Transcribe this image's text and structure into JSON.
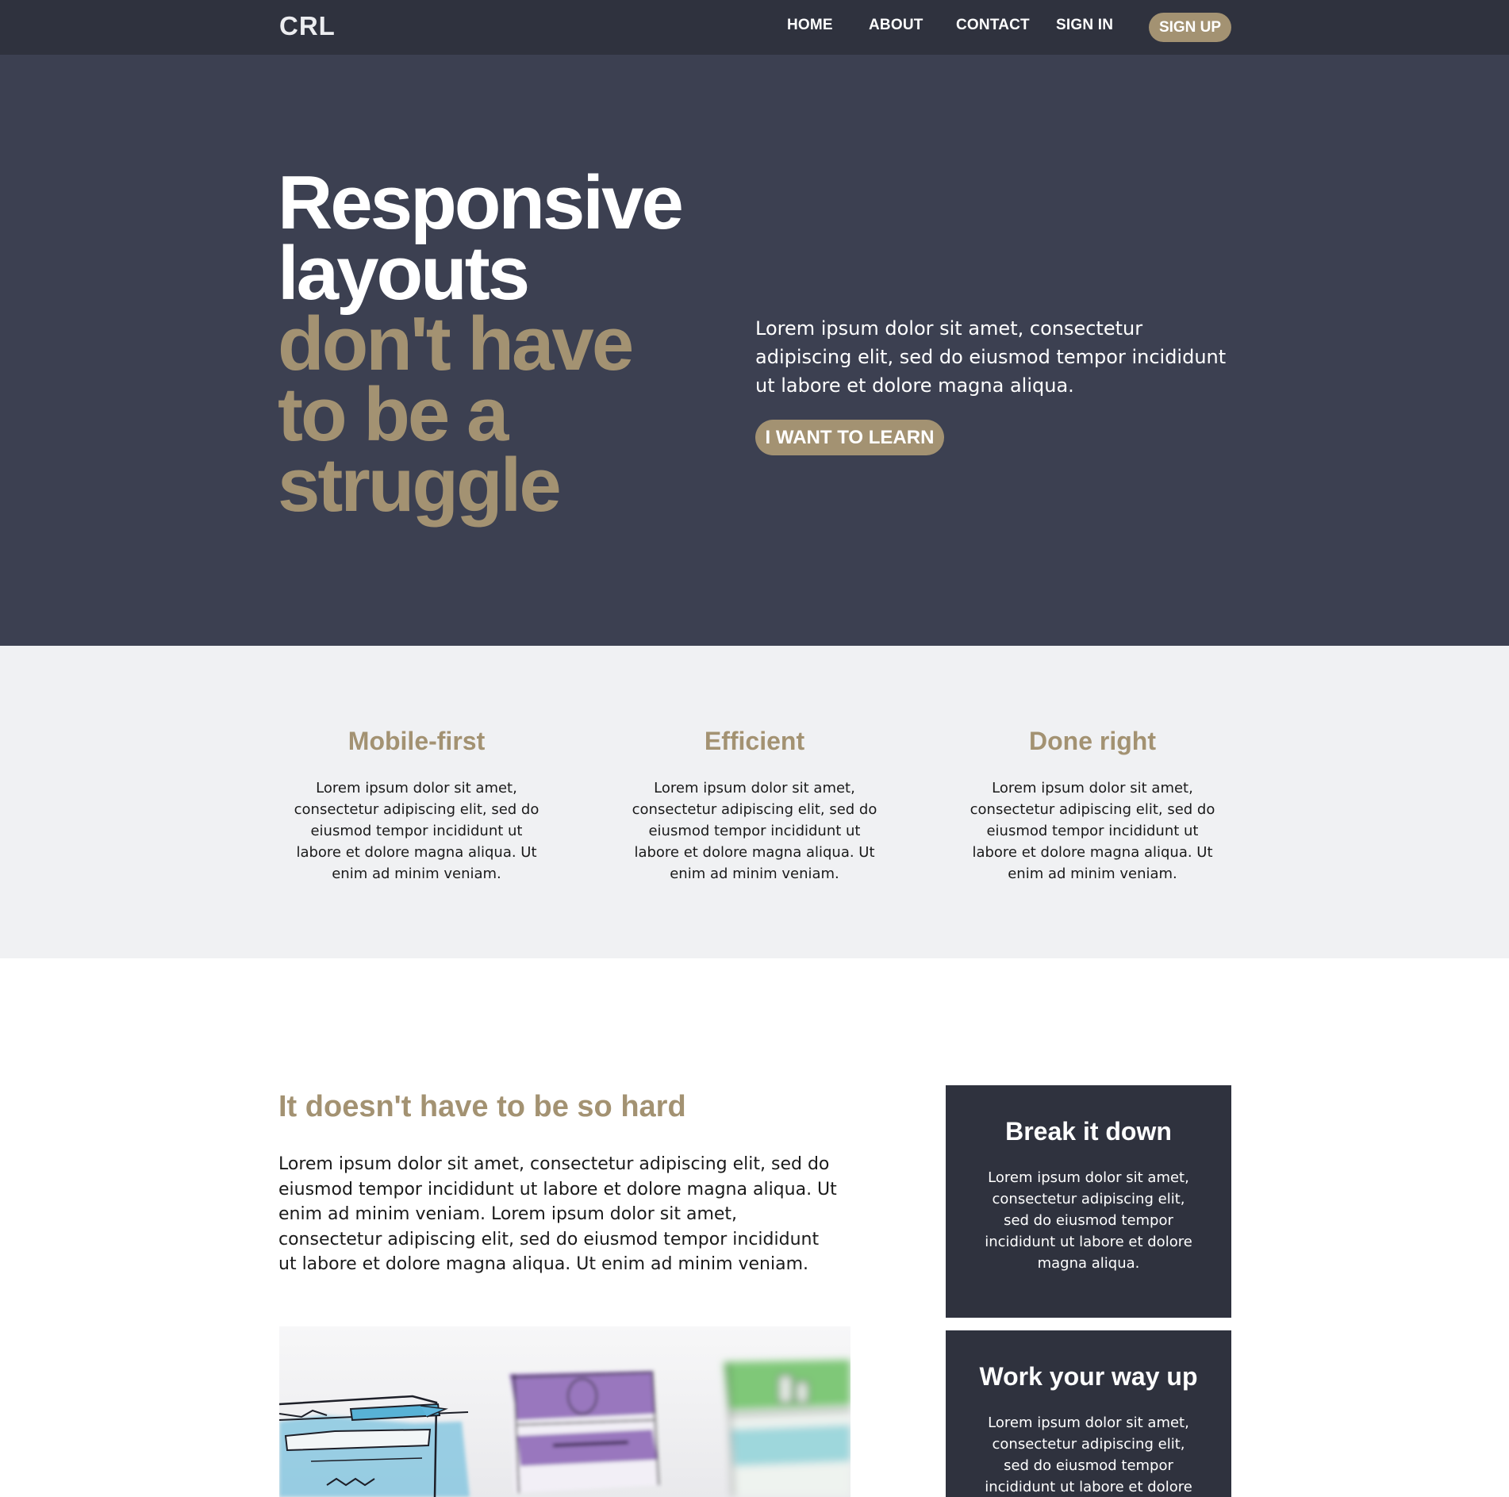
{
  "nav": {
    "logo": "CRL",
    "links": [
      "HOME",
      "ABOUT",
      "CONTACT",
      "SIGN IN"
    ],
    "cta": "SIGN UP"
  },
  "hero": {
    "title_white": "Responsive layouts",
    "title_accent": "don't have to be a struggle",
    "text": "Lorem ipsum dolor sit amet, consectetur adipiscing elit, sed do eiusmod tempor incididunt ut labore et dolore magna aliqua.",
    "cta": "I WANT TO LEARN"
  },
  "features": [
    {
      "title": "Mobile-first",
      "text": "Lorem ipsum dolor sit amet, consectetur adipiscing elit, sed do eiusmod tempor incididunt ut labore et dolore magna aliqua. Ut enim ad minim veniam."
    },
    {
      "title": "Efficient",
      "text": "Lorem ipsum dolor sit amet, consectetur adipiscing elit, sed do eiusmod tempor incididunt ut labore et dolore magna aliqua. Ut enim ad minim veniam."
    },
    {
      "title": "Done right",
      "text": "Lorem ipsum dolor sit amet, consectetur adipiscing elit, sed do eiusmod tempor incididunt ut labore et dolore magna aliqua. Ut enim ad minim veniam."
    }
  ],
  "about": {
    "title": "It doesn't have to be so hard",
    "text": "Lorem ipsum dolor sit amet, consectetur adipiscing elit, sed do eiusmod tempor incididunt ut labore et dolore magna aliqua. Ut enim ad minim veniam. Lorem ipsum dolor sit amet, consectetur adipiscing elit, sed do eiusmod tempor incididunt ut labore et dolore magna aliqua. Ut enim ad minim veniam."
  },
  "cards": [
    {
      "title": "Break it down",
      "text": "Lorem ipsum dolor sit amet, consectetur adipiscing elit, sed do eiusmod tempor incididunt ut labore et dolore magna aliqua."
    },
    {
      "title": "Work your way up",
      "text": "Lorem ipsum dolor sit amet, consectetur adipiscing elit, sed do eiusmod tempor incididunt ut labore et dolore magna aliqua."
    }
  ],
  "colors": {
    "navbar": "#2f323e",
    "hero_bg": "#3c4051",
    "accent": "#a39272",
    "features_bg": "#f0f1f3",
    "card_bg": "#2f323e"
  }
}
